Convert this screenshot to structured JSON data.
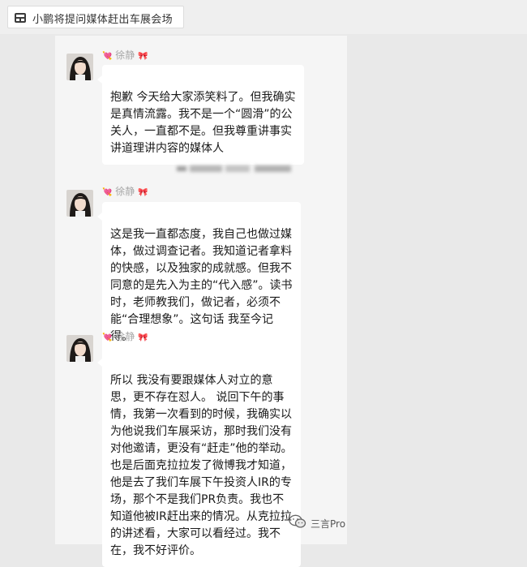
{
  "window": {
    "tab_title": "小鹏将提问媒体赶出车展会场"
  },
  "chat": {
    "sender_name": "徐静",
    "messages": [
      {
        "text": "抱歉 今天给大家添笑料了。但我确实是真情流露。我不是一个“圆滑”的公关人，一直都不是。但我尊重讲事实 讲道理讲内容的媒体人"
      },
      {
        "text": "这是我一直都态度，我自己也做过媒体，做过调查记者。我知道记者拿料的快感，以及独家的成就感。但我不同意的是先入为主的“代入感”。读书时，老师教我们，做记者，必须不能“合理想象”。这句话 我至今记得。"
      },
      {
        "text": "所以 我没有要跟媒体人对立的意思，更不存在怼人。 说回下午的事情，我第一次看到的时候，我确实以为他说我们车展采访，那时我们没有对他邀请，更没有“赶走”他的举动。也是后面克拉拉发了微博我才知道，他是去了我们车展下午投资人IR的专场，那个不是我们PR负责。我也不知道他被IR赶出来的情况。从克拉拉的讲述看，大家可以看经过。我不在，我不好评价。"
      }
    ]
  },
  "watermark": {
    "text": "三言Pro",
    "icon": "wechat-icon"
  },
  "colors": {
    "page_bg": "#e9e9e9",
    "chat_bg": "#f5f5f5",
    "bubble_bg": "#ffffff",
    "sender_name": "#a8a8a8",
    "heart": "#e55a7a"
  }
}
